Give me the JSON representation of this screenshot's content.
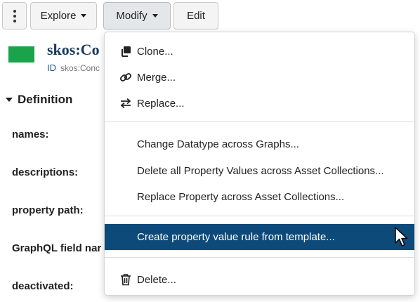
{
  "toolbar": {
    "more_icon": "kebab-vertical-icon",
    "explore_label": "Explore",
    "modify_label": "Modify",
    "edit_label": "Edit"
  },
  "header": {
    "title": "skos:Co",
    "id_label": "ID",
    "id_value": "skos:Conc",
    "type_color": "#1aa34a"
  },
  "definition": {
    "heading": "Definition",
    "fields": {
      "names": "names:",
      "descriptions": "descriptions:",
      "property_path": "property path:",
      "graphql_field_name": "GraphQL field nar",
      "deactivated": "deactivated:"
    }
  },
  "menu": {
    "clone": "Clone...",
    "merge": "Merge...",
    "replace": "Replace...",
    "change_datatype": "Change Datatype across Graphs...",
    "delete_property_values": "Delete all Property Values across Asset Collections...",
    "replace_property": "Replace Property across Asset Collections...",
    "create_rule": "Create property value rule from template...",
    "delete": "Delete...",
    "highlight_color": "#0d4a7a"
  }
}
